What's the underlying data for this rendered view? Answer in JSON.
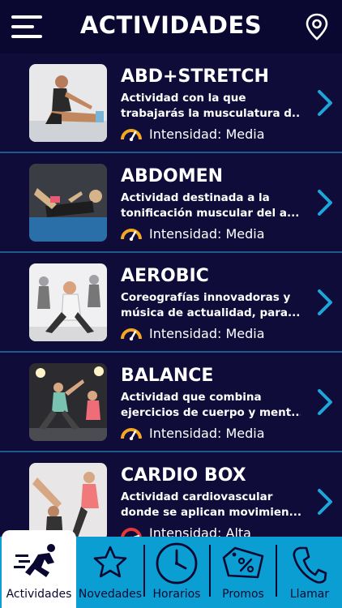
{
  "header": {
    "title": "ACTIVIDADES",
    "menu_icon": "hamburger-menu-icon",
    "location_icon": "location-pin-icon"
  },
  "activities": [
    {
      "name": "ABD+STRETCH",
      "desc_line1": "Actividad con la que",
      "desc_line2": "trabajarás la musculatura d...",
      "intensity": "Intensidad: Media",
      "gauge_color": "#f5a623"
    },
    {
      "name": "ABDOMEN",
      "desc_line1": "Actividad destinada a la",
      "desc_line2": "tonificación muscular del a...",
      "intensity": "Intensidad: Media",
      "gauge_color": "#f5a623"
    },
    {
      "name": "AEROBIC",
      "desc_line1": "Coreografías innovadoras y",
      "desc_line2": "música de actualidad, para...",
      "intensity": "Intensidad: Media",
      "gauge_color": "#f5a623"
    },
    {
      "name": "BALANCE",
      "desc_line1": "Actividad que combina",
      "desc_line2": "ejercicios de cuerpo y ment...",
      "intensity": "Intensidad: Media",
      "gauge_color": "#f5a623"
    },
    {
      "name": "CARDIO BOX",
      "desc_line1": "Actividad cardiovascular",
      "desc_line2": "donde se aplican movimien...",
      "intensity": "Intensidad: Alta",
      "gauge_color": "#e53935"
    }
  ],
  "tabs": [
    {
      "label": "Actividades",
      "icon": "runner-icon",
      "active": true
    },
    {
      "label": "Novedades",
      "icon": "star-icon",
      "active": false
    },
    {
      "label": "Horarios",
      "icon": "clock-icon",
      "active": false
    },
    {
      "label": "Promos",
      "icon": "discount-tag-icon",
      "active": false
    },
    {
      "label": "Llamar",
      "icon": "phone-icon",
      "active": false
    }
  ],
  "colors": {
    "background": "#0f0c3a",
    "header": "#0a0830",
    "accent": "#1ea6d9",
    "tabbar": "#0b9ed3",
    "divider": "#1e5a8c"
  }
}
